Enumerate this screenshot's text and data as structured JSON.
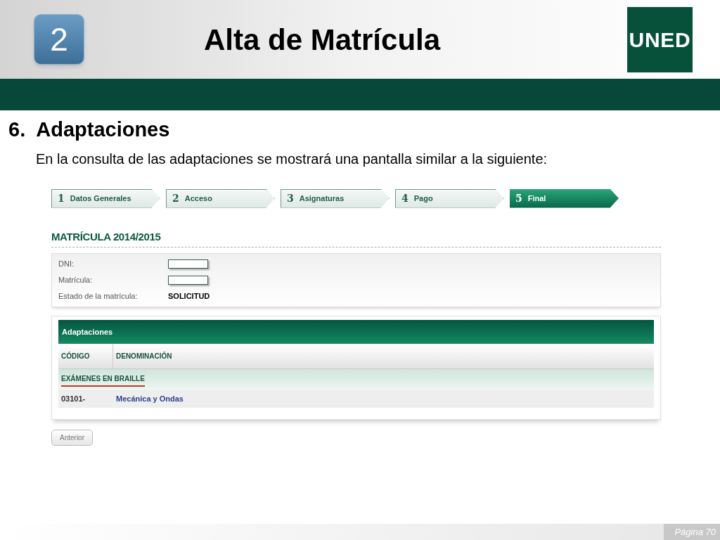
{
  "slide": {
    "number_badge": "2",
    "title": "Alta de Matrícula",
    "logo": "UNED",
    "section_heading": "6.  Adaptaciones",
    "intro": "En la consulta de las adaptaciones se mostrará una pantalla similar a la siguiente:",
    "page_label": "Página 70"
  },
  "screen": {
    "steps": [
      {
        "number": "1",
        "label": "Datos Generales",
        "selected": false
      },
      {
        "number": "2",
        "label": "Acceso",
        "selected": false
      },
      {
        "number": "3",
        "label": "Asignaturas",
        "selected": false
      },
      {
        "number": "4",
        "label": "Pago",
        "selected": false
      },
      {
        "number": "5",
        "label": "Final",
        "selected": true
      }
    ],
    "heading": "MATRÍCULA 2014/2015",
    "fields": [
      {
        "kind": "input",
        "label": "DNI:"
      },
      {
        "kind": "input",
        "label": "Matrícula:"
      },
      {
        "kind": "text",
        "label": "Estado de la matrícula:",
        "value": "SOLICITUD"
      }
    ],
    "table": {
      "title": "Adaptaciones",
      "columns": [
        "CÓDIGO",
        "DENOMINACIÓN"
      ],
      "groups": [
        {
          "name": "EXÁMENES EN BRAILLE",
          "rows": [
            {
              "code": "03101-",
              "name": "Mecánica y Ondas"
            }
          ]
        }
      ]
    },
    "back_button": "Anterior"
  }
}
